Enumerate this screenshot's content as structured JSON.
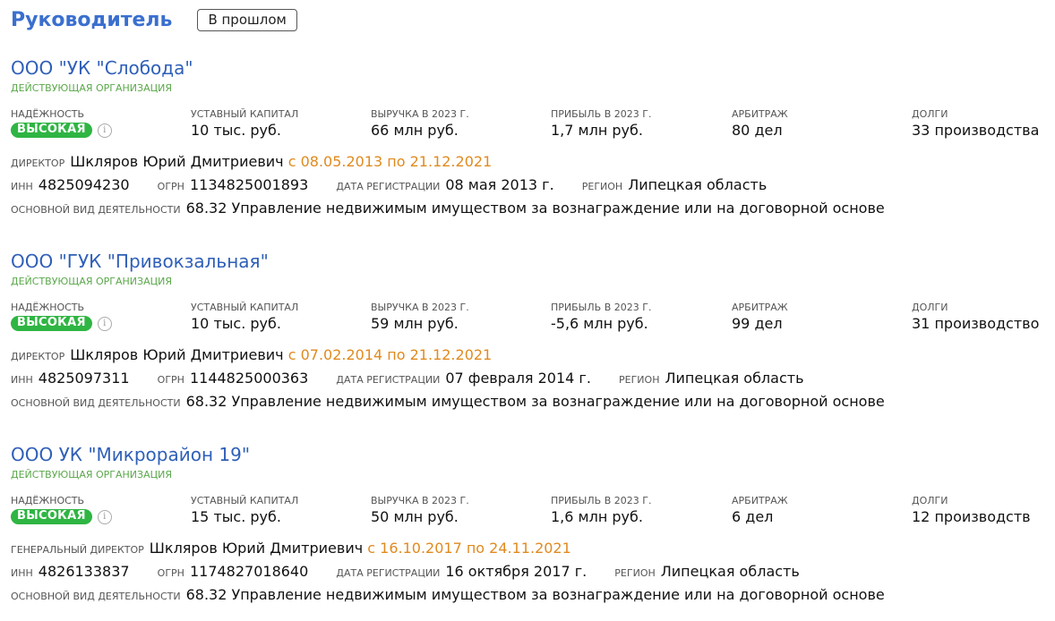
{
  "header": {
    "title": "Руководитель",
    "past_button": "В прошлом"
  },
  "labels": {
    "reliability": "НАДЁЖНОСТЬ",
    "capital": "УСТАВНЫЙ КАПИТАЛ",
    "revenue": "ВЫРУЧКА В 2023 Г.",
    "profit": "ПРИБЫЛЬ В 2023 Г.",
    "arbitration": "АРБИТРАЖ",
    "debts": "ДОЛГИ",
    "inn": "ИНН",
    "ogrn": "ОГРН",
    "reg_date": "ДАТА РЕГИСТРАЦИИ",
    "region": "РЕГИОН",
    "activity": "ОСНОВНОЙ ВИД ДЕЯТЕЛЬНОСТИ"
  },
  "colors": {
    "title": "#3a6fcf",
    "org_link": "#2f5fb8",
    "status": "#5aa84a",
    "badge": "#2fb543",
    "period": "#e08a1e"
  },
  "orgs": [
    {
      "name": "ООО \"УК \"Слобода\"",
      "status": "ДЕЙСТВУЮЩАЯ ОРГАНИЗАЦИЯ",
      "reliability": "ВЫСОКАЯ",
      "capital": "10 тыс. руб.",
      "revenue": "66 млн руб.",
      "profit": "1,7 млн руб.",
      "arbitration": "80 дел",
      "debts": "33 производства",
      "role": "ДИРЕКТОР",
      "person": "Шкляров Юрий Дмитриевич",
      "period": "с 08.05.2013 по 21.12.2021",
      "inn": "4825094230",
      "ogrn": "1134825001893",
      "reg_date": "08 мая 2013 г.",
      "region": "Липецкая область",
      "activity": "68.32 Управление недвижимым имуществом за вознаграждение или на договорной основе"
    },
    {
      "name": "ООО \"ГУК \"Привокзальная\"",
      "status": "ДЕЙСТВУЮЩАЯ ОРГАНИЗАЦИЯ",
      "reliability": "ВЫСОКАЯ",
      "capital": "10 тыс. руб.",
      "revenue": "59 млн руб.",
      "profit": "-5,6 млн руб.",
      "arbitration": "99 дел",
      "debts": "31 производство",
      "role": "ДИРЕКТОР",
      "person": "Шкляров Юрий Дмитриевич",
      "period": "с 07.02.2014 по 21.12.2021",
      "inn": "4825097311",
      "ogrn": "1144825000363",
      "reg_date": "07 февраля 2014 г.",
      "region": "Липецкая область",
      "activity": "68.32 Управление недвижимым имуществом за вознаграждение или на договорной основе"
    },
    {
      "name": "ООО УК \"Микрорайон 19\"",
      "status": "ДЕЙСТВУЮЩАЯ ОРГАНИЗАЦИЯ",
      "reliability": "ВЫСОКАЯ",
      "capital": "15 тыс. руб.",
      "revenue": "50 млн руб.",
      "profit": "1,6 млн руб.",
      "arbitration": "6 дел",
      "debts": "12 производств",
      "role": "ГЕНЕРАЛЬНЫЙ ДИРЕКТОР",
      "person": "Шкляров Юрий Дмитриевич",
      "period": "с 16.10.2017 по 24.11.2021",
      "inn": "4826133837",
      "ogrn": "1174827018640",
      "reg_date": "16 октября 2017 г.",
      "region": "Липецкая область",
      "activity": "68.32 Управление недвижимым имуществом за вознаграждение или на договорной основе"
    }
  ]
}
